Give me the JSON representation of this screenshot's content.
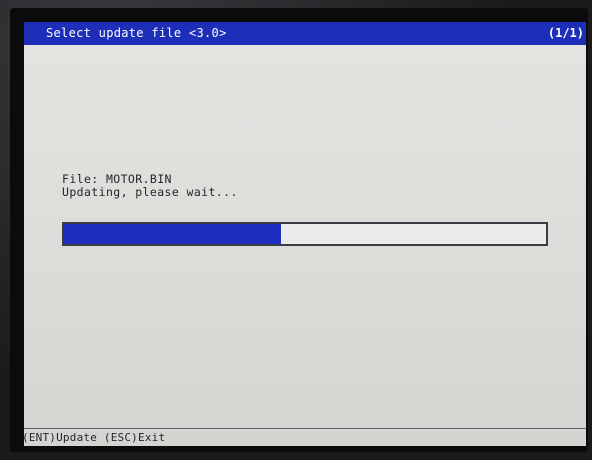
{
  "header": {
    "title": "Select update file <3.0>",
    "page_indicator": "(1/1)"
  },
  "update": {
    "file_line": "File: MOTOR.BIN",
    "status_line": "Updating, please wait...",
    "progress_fraction": 0.45
  },
  "footer": {
    "update_key": "(ENT)Update",
    "exit_key": "(ESC)Exit"
  },
  "colors": {
    "accent_blue": "#1d2fb8",
    "screen_background": "#e2e0dd",
    "text": "#24262e"
  }
}
